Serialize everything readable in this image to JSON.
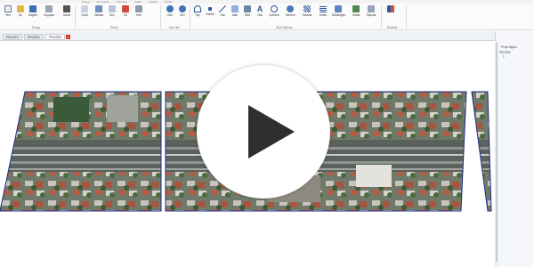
{
  "menu": {
    "tabs": [
      "Dosya",
      "Ana Sayfa",
      "Görünüm",
      "Analiz",
      "Araçlar",
      "Yardım"
    ]
  },
  "ribbon": {
    "groups": {
      "dosya": "Dosya",
      "duzen": "Düzen",
      "geri_ileri": "Geri İleri",
      "olcu_olcumu": "Ölçü Ölçümü",
      "duzenle": "Düzenle"
    },
    "tools": [
      {
        "label": "Yeni",
        "icon": "new-file-icon"
      },
      {
        "label": "Aç",
        "icon": "open-folder-icon"
      },
      {
        "label": "Kaydet",
        "icon": "save-icon"
      },
      {
        "label": "Kopyala",
        "icon": "copy-icon"
      },
      {
        "label": "Yazdır",
        "icon": "print-icon"
      },
      {
        "label": "Çizici",
        "icon": "pen-icon"
      },
      {
        "label": "Tabaka",
        "icon": "layers-icon"
      },
      {
        "label": "Seç",
        "icon": "select-icon"
      },
      {
        "label": "Sil",
        "icon": "delete-icon"
      },
      {
        "label": "Kes",
        "icon": "cut-icon"
      },
      {
        "label": "Geri",
        "icon": "undo-icon"
      },
      {
        "label": "İleri",
        "icon": "redo-icon"
      },
      {
        "label": "Yay",
        "icon": "arc-icon"
      },
      {
        "label": "Noktla",
        "icon": "point-icon"
      },
      {
        "label": "Hat",
        "icon": "line-icon"
      },
      {
        "label": "Alan",
        "icon": "area-icon"
      },
      {
        "label": "Ölçü",
        "icon": "measure-icon"
      },
      {
        "label": "Yazı",
        "icon": "text-icon"
      },
      {
        "label": "Çember",
        "icon": "circle-icon"
      },
      {
        "label": "Sembol",
        "icon": "symbol-icon"
      },
      {
        "label": "Tarama",
        "icon": "hatch-icon"
      },
      {
        "label": "Kafes",
        "icon": "grid-icon"
      },
      {
        "label": "Dikdörtgen",
        "icon": "rectangle-icon"
      },
      {
        "label": "Harita",
        "icon": "map-icon"
      },
      {
        "label": "Sayısal",
        "icon": "numeric-icon"
      }
    ]
  },
  "doc_tabs": [
    {
      "label": "PROJE3",
      "active": false
    },
    {
      "label": "PROJE4",
      "active": false
    },
    {
      "label": "PROJE5",
      "active": true
    }
  ],
  "right_panel": {
    "title": "Proje Ağacı",
    "tree": [
      "PROJE5",
      "1"
    ]
  },
  "colors": {
    "accent": "#2b579a",
    "close_tab": "#d9342b",
    "map_outline": "#1f2d8a",
    "play_triangle": "#2f2f2f"
  }
}
